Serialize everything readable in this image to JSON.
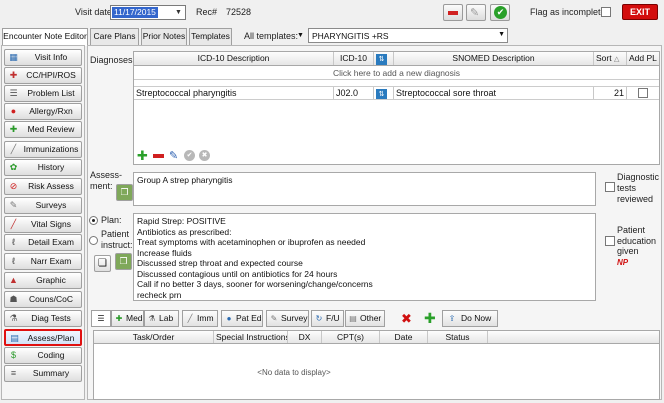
{
  "header": {
    "visit_date_label": "Visit date:",
    "visit_date_value": "11/17/2015",
    "rec_label": "Rec#",
    "rec_value": "72528",
    "flag_label": "Flag as incomplete",
    "exit_label": "EXIT"
  },
  "tabs": {
    "items": [
      "Encounter Note Editor",
      "Care Plans",
      "Prior Notes",
      "Templates"
    ],
    "all_templates_label": "All templates:",
    "template_value": "PHARYNGITIS +RS"
  },
  "sidebar": {
    "items": [
      {
        "label": "Visit Info",
        "icon": "visit-info-icon"
      },
      {
        "label": "CC/HPI/ROS",
        "icon": "cc-hpi-icon"
      },
      {
        "label": "Problem List",
        "icon": "problem-list-icon"
      },
      {
        "label": "Allergy/Rxn",
        "icon": "allergy-icon"
      },
      {
        "label": "Med Review",
        "icon": "med-review-icon"
      },
      {
        "label": "Immunizations",
        "icon": "syringe-icon"
      },
      {
        "label": "History",
        "icon": "history-icon"
      },
      {
        "label": "Risk Assess",
        "icon": "risk-icon"
      },
      {
        "label": "Surveys",
        "icon": "survey-icon"
      },
      {
        "label": "Vital Signs",
        "icon": "vitals-icon"
      },
      {
        "label": "Detail Exam",
        "icon": "stethoscope-icon"
      },
      {
        "label": "Narr Exam",
        "icon": "stethoscope-icon"
      },
      {
        "label": "Graphic",
        "icon": "graphic-icon"
      },
      {
        "label": "Couns/CoC",
        "icon": "counsel-icon"
      },
      {
        "label": "Diag Tests",
        "icon": "diag-tests-icon"
      },
      {
        "label": "Assess/Plan",
        "icon": "assess-plan-icon"
      },
      {
        "label": "Coding",
        "icon": "dollar-icon"
      },
      {
        "label": "Summary",
        "icon": "summary-icon"
      }
    ]
  },
  "diagnoses": {
    "label": "Diagnoses:",
    "headers": {
      "icd10_desc": "ICD-10 Description",
      "icd10": "ICD-10",
      "snomed": "SNOMED Description",
      "sort": "Sort",
      "add_pl": "Add PL"
    },
    "add_row_text": "Click here to add a new diagnosis",
    "rows": [
      {
        "desc": "Streptococcal pharyngitis",
        "code": "J02.0",
        "snomed": "Streptococcal sore throat",
        "sort": "21"
      }
    ]
  },
  "assessment": {
    "label": "Assess-\nment:",
    "text": "Group A strep pharyngitis",
    "diag_tests_label": "Diagnostic\ntests\nreviewed"
  },
  "plan": {
    "plan_label": "Plan:",
    "patient_instruct_label": "Patient\ninstruct:",
    "text": "Rapid Strep: POSITIVE\nAntibiotics as prescribed:\nTreat symptoms with acetaminophen or ibuprofen as needed\nIncrease fluids\nDiscussed strep throat and expected course\nDiscussed contagious until on antibiotics for 24 hours\nCall if no better 3 days, sooner for worsening/change/concerns\nrecheck prn",
    "pt_edu_label": "Patient\neducation\ngiven",
    "np_mark": "NP"
  },
  "orders": {
    "tabs": [
      "Med",
      "Lab",
      "Imm",
      "Pat Ed",
      "Survey",
      "F/U",
      "Other"
    ],
    "do_now": "Do Now",
    "headers": [
      "Task/Order",
      "Special Instructions",
      "DX",
      "CPT(s)",
      "Date",
      "Status"
    ],
    "empty": "<No data to display>"
  },
  "colors": {
    "accent": "#3366cc",
    "exit": "#d30d0d",
    "highlight": "#e01010"
  }
}
